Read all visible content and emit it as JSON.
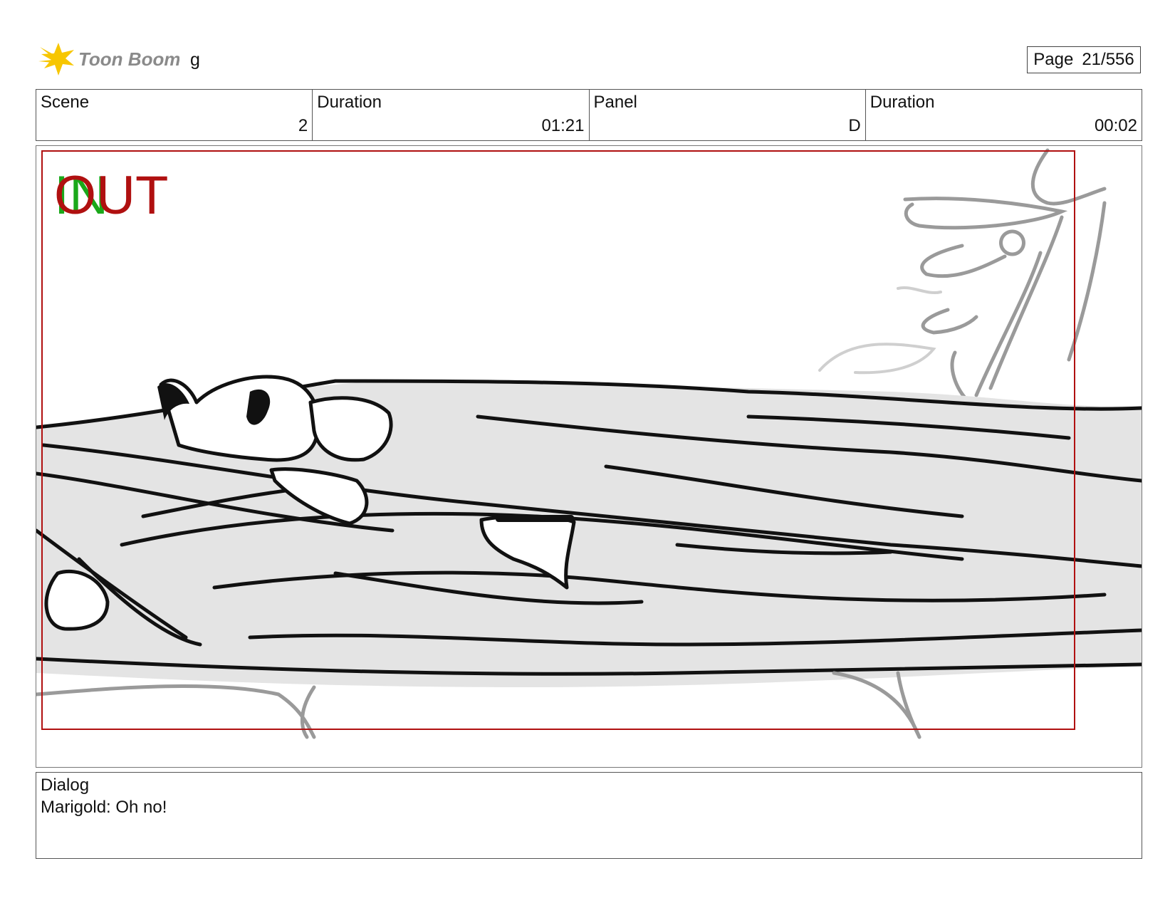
{
  "header": {
    "brand_name": "Toon Boom",
    "project_name": "g",
    "page_label": "Page",
    "page_value": "21/556"
  },
  "info": {
    "scene_label": "Scene",
    "scene_value": "2",
    "scene_duration_label": "Duration",
    "scene_duration_value": "01:21",
    "panel_label": "Panel",
    "panel_value": "D",
    "panel_duration_label": "Duration",
    "panel_duration_value": "00:02"
  },
  "panel": {
    "in_marker": "IN",
    "out_marker": "OUT",
    "in_color": "#1aa81a",
    "out_color": "#b01010",
    "frame_color": "#b01010"
  },
  "dialog": {
    "label": "Dialog",
    "text": "Marigold: Oh no!"
  },
  "colors": {
    "logo_star": "#f7c600",
    "logo_text": "#8a8a8a"
  }
}
